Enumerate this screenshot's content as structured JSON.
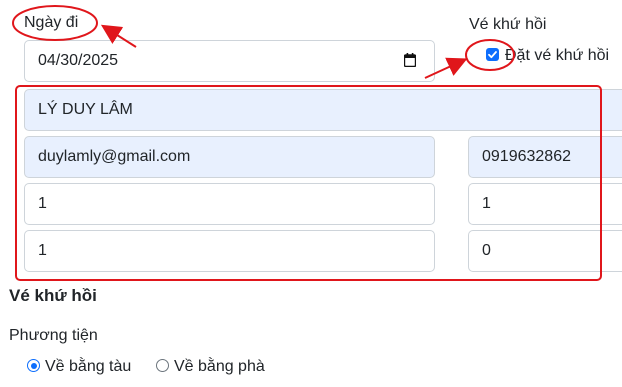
{
  "trip": {
    "departure_label": "Ngày đi",
    "departure_value": "04/30/2025",
    "return_label": "Vé khứ hồi",
    "return_checkbox_label": "Đặt vé khứ hồi",
    "return_checked": true
  },
  "passenger": {
    "name_value": "LÝ DUY LÂM",
    "email_value": "duylamly@gmail.com",
    "phone_value": "0919632862",
    "qty_row1_left": "1",
    "qty_row1_right": "1",
    "qty_row2_left": "1",
    "qty_row2_right": "0"
  },
  "return_section": {
    "heading": "Vé khứ hồi",
    "transport_label": "Phương tiện",
    "options": [
      {
        "label": "Về bằng tàu",
        "selected": true
      },
      {
        "label": "Về bằng phà",
        "selected": false
      }
    ]
  },
  "colors": {
    "accent": "#0d6efd",
    "annotation": "#e0161b",
    "autofill": "#e8f0fe"
  }
}
